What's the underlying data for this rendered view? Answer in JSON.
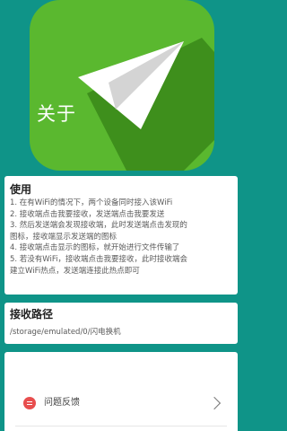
{
  "hero": {
    "app_icon": "paper-plane-icon",
    "title": "关于"
  },
  "usage": {
    "title": "使用",
    "steps": [
      "1. 在有WiFi的情况下，两个设备同时接入该WiFi",
      "2. 接收端点击我要接收，发送端点击我要发送",
      "3. 然后发送端会发现接收端，此时发送端点击发现的",
      "图标，接收端显示发送端的图标",
      "4. 接收端点击显示的图标，就开始进行文件传输了",
      "5. 若没有WiFi，接收端点击我要接收，此时接收端会",
      "建立WiFi热点，发送端连接此热点即可"
    ]
  },
  "receive_path": {
    "title": "接收路径",
    "value": "/storage/emulated/0/闪电换机"
  },
  "feedback": {
    "icon": "feedback-icon",
    "label": "问题反馈"
  },
  "colors": {
    "background": "#0f9488",
    "icon_green": "#5ab82f",
    "card": "#ffffff",
    "feedback_icon": "#e84e4e"
  }
}
